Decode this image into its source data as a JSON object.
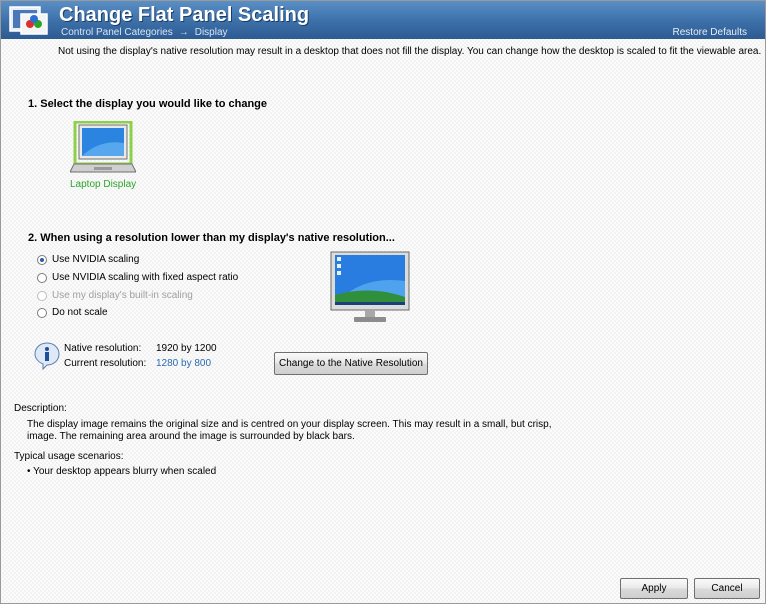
{
  "header": {
    "title": "Change Flat Panel Scaling",
    "breadcrumb": {
      "parent": "Control Panel Categories",
      "separator": "→",
      "current": "Display"
    },
    "restore_defaults": "Restore Defaults",
    "icon": "nvidia-control-panel-icon"
  },
  "intro": "Not using the display's native resolution may result in a desktop that does not fill the display. You can change how the desktop is scaled to fit the viewable area.",
  "section1": {
    "title": "1. Select the display you would like to change",
    "display_label": "Laptop Display",
    "display_icon": "laptop-icon"
  },
  "section2": {
    "title": "2. When using a resolution lower than my display's native resolution...",
    "options": [
      {
        "label": "Use NVIDIA scaling",
        "checked": true,
        "disabled": false
      },
      {
        "label": "Use NVIDIA scaling with fixed aspect ratio",
        "checked": false,
        "disabled": false
      },
      {
        "label": "Use my display's built-in scaling",
        "checked": false,
        "disabled": true
      },
      {
        "label": "Do not scale",
        "checked": false,
        "disabled": false
      }
    ],
    "preview_icon": "monitor-preview-icon"
  },
  "resolution": {
    "native_label": "Native resolution:",
    "native_value": "1920 by 1200",
    "current_label": "Current resolution:",
    "current_value": "1280 by 800",
    "change_button": "Change to the Native Resolution",
    "info_icon": "info-icon"
  },
  "description": {
    "heading": "Description:",
    "line1": "The display image remains the original size and is centred on your display screen. This may result in a small, but crisp,",
    "line2": "image. The remaining area around the image is surrounded by black bars.",
    "scenarios_heading": "Typical usage scenarios:",
    "scenario1": "• Your desktop appears blurry when scaled"
  },
  "buttons": {
    "apply": "Apply",
    "cancel": "Cancel"
  },
  "colors": {
    "header": "#3c6fa8",
    "laptop_label": "#2aa52a",
    "link_value": "#2a6bb3"
  }
}
